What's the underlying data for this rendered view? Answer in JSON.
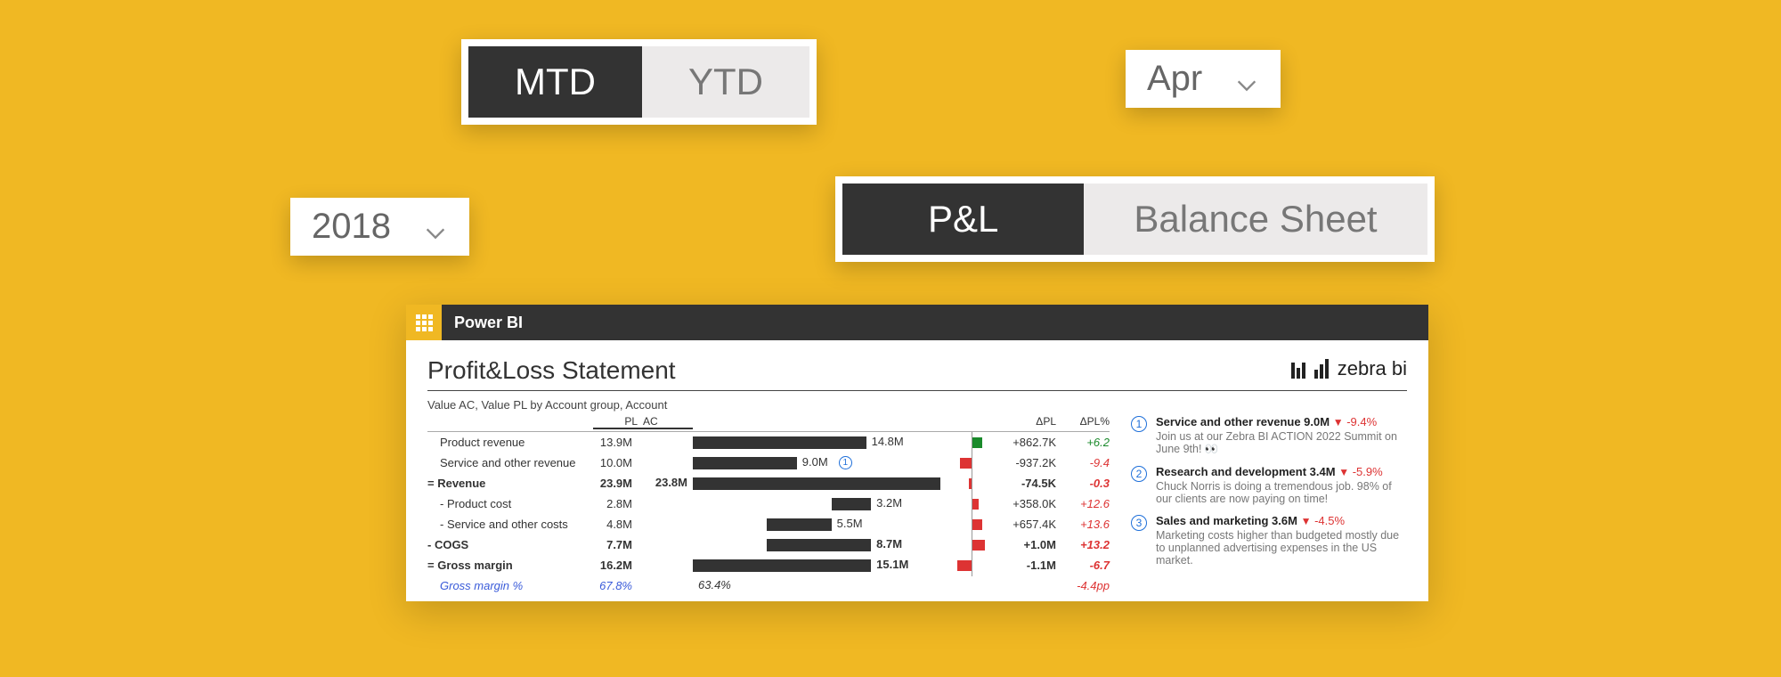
{
  "slicers": {
    "mtd_ytd": {
      "mtd": "MTD",
      "ytd": "YTD"
    },
    "month": "Apr",
    "year": "2018",
    "pl_bs": {
      "pl": "P&L",
      "bs": "Balance Sheet"
    }
  },
  "report": {
    "app": "Power BI",
    "title": "Profit&Loss Statement",
    "brand": "zebra bi",
    "subhead": "Value AC, Value PL by Account group, Account",
    "cols": {
      "pl": "PL",
      "ac": "AC",
      "dpl": "ΔPL",
      "dplp": "ΔPL%"
    },
    "rows": [
      {
        "label": "Product revenue",
        "pl": "13.9M",
        "ac": "14.8M",
        "bar": 70,
        "dpl": "+862.7K",
        "dplp": "+6.2",
        "sign": "pos",
        "dwidth": 12,
        "dside": "right"
      },
      {
        "label": "Service and other revenue",
        "pl": "10.0M",
        "ac": "9.0M",
        "bar": 42,
        "dpl": "-937.2K",
        "dplp": "-9.4",
        "sign": "neg",
        "dwidth": 13,
        "dside": "left",
        "fn": "1"
      },
      {
        "label": "= Revenue",
        "bold": true,
        "pl": "23.9M",
        "ac": "23.8M",
        "bar": 100,
        "dpl": "-74.5K",
        "dplp": "-0.3",
        "sign": "neg",
        "dwidth": 3,
        "dside": "left"
      },
      {
        "label": "- Product cost",
        "pl": "2.8M",
        "ac": "3.2M",
        "bar": 16,
        "baroffset": 56,
        "dpl": "+358.0K",
        "dplp": "+12.6",
        "sign": "neg",
        "dwidth": 8,
        "dside": "right"
      },
      {
        "label": "- Service and other costs",
        "pl": "4.8M",
        "ac": "5.5M",
        "bar": 26,
        "baroffset": 30,
        "dpl": "+657.4K",
        "dplp": "+13.6",
        "sign": "neg",
        "dwidth": 12,
        "dside": "right"
      },
      {
        "label": "- COGS",
        "bold": true,
        "pl": "7.7M",
        "ac": "8.7M",
        "bar": 42,
        "baroffset": 30,
        "dpl": "+1.0M",
        "dplp": "+13.2",
        "sign": "neg",
        "dwidth": 15,
        "dside": "right"
      },
      {
        "label": "= Gross margin",
        "bold": true,
        "pl": "16.2M",
        "ac": "15.1M",
        "bar": 72,
        "dpl": "-1.1M",
        "dplp": "-6.7",
        "sign": "neg",
        "dwidth": 16,
        "dside": "left"
      },
      {
        "label": "Gross margin %",
        "italic": true,
        "pl": "67.8%",
        "ac": "63.4%",
        "dpl": "",
        "dplp": "-4.4pp",
        "sign": "neg"
      }
    ],
    "notes": [
      {
        "n": "1",
        "head": "Service and other revenue 9.0M",
        "delta": "-9.4%",
        "body": "Join us at our Zebra BI ACTION 2022 Summit on June 9th! 👀"
      },
      {
        "n": "2",
        "head": "Research and development 3.4M",
        "delta": "-5.9%",
        "body": "Chuck Norris is doing a tremendous job. 98% of our clients are now paying on time!"
      },
      {
        "n": "3",
        "head": "Sales and marketing 3.6M",
        "delta": "-4.5%",
        "body": "Marketing costs higher than budgeted mostly due to unplanned advertising expenses in the US market."
      }
    ]
  }
}
